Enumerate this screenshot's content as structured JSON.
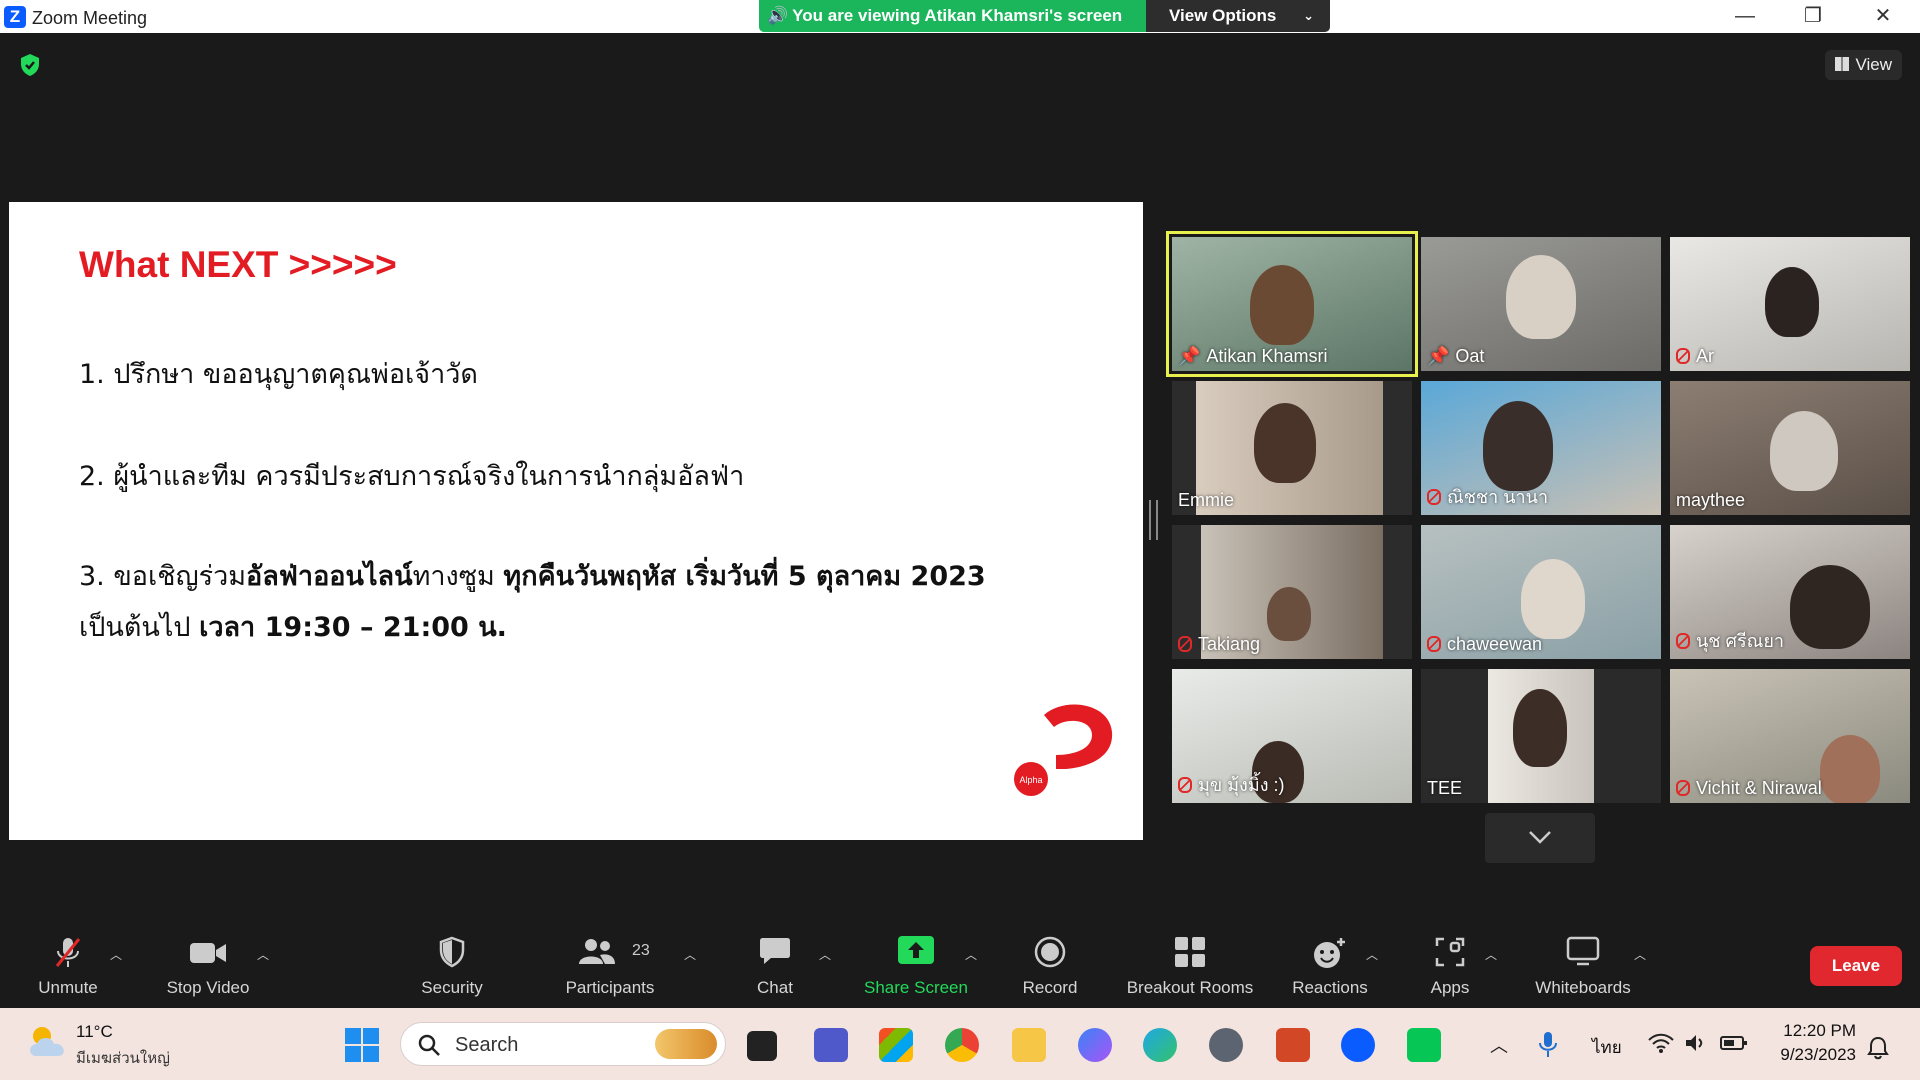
{
  "window": {
    "title": "Zoom Meeting",
    "viewing_banner": "You are viewing Atikan Khamsri's screen",
    "view_options": "View Options"
  },
  "view_button": "View",
  "slide": {
    "title": "What NEXT  >>>>>",
    "item1": "1. ปรึกษา ขออนุญาตคุณพ่อเจ้าวัด",
    "item2": "2. ผู้นำและทีม ควรมีประสบการณ์จริงในการนำกลุ่มอัลฟ่า",
    "item3_a": "3. ขอเชิญร่วม",
    "item3_b": "อัลฟ่าออนไลน์",
    "item3_c": "ทางซูม ",
    "item3_d": "ทุกคืนวันพฤหัส เริ่มวันที่ 5 ตุลาคม 2023",
    "item3_e": "เป็นต้นไป ",
    "item3_f": "เวลา 19:30 – 21:00 น.",
    "logo_text": "Alpha"
  },
  "participants": [
    {
      "name": "Atikan Khamsri",
      "status": "pinned"
    },
    {
      "name": "Oat",
      "status": "pinned"
    },
    {
      "name": "Ar",
      "status": "muted"
    },
    {
      "name": "Emmie",
      "status": "none"
    },
    {
      "name": "ณิชชา นานา",
      "status": "muted"
    },
    {
      "name": "maythee",
      "status": "none"
    },
    {
      "name": "Takiang",
      "status": "muted"
    },
    {
      "name": "chaweewan",
      "status": "muted"
    },
    {
      "name": "นุช ศรีณยา",
      "status": "muted"
    },
    {
      "name": "มุข มุ้งมิ้ง :)",
      "status": "muted"
    },
    {
      "name": "TEE",
      "status": "none"
    },
    {
      "name": "Vichit & Nirawal",
      "status": "muted"
    }
  ],
  "toolbar": {
    "unmute": "Unmute",
    "stop_video": "Stop Video",
    "security": "Security",
    "participants": "Participants",
    "participants_count": "23",
    "chat": "Chat",
    "share_screen": "Share Screen",
    "record": "Record",
    "breakout_rooms": "Breakout Rooms",
    "reactions": "Reactions",
    "apps": "Apps",
    "whiteboards": "Whiteboards",
    "leave": "Leave"
  },
  "taskbar": {
    "weather_temp": "11°C",
    "weather_location": "มีเมฆส่วนใหญ่",
    "search_placeholder": "Search",
    "language": "ไทย",
    "time": "12:20 PM",
    "date": "9/23/2023"
  },
  "colors": {
    "slide_title": "#e31b23",
    "banner_green": "#1bb55c",
    "share_green": "#23d959",
    "leave_red": "#e0282e",
    "active_speaker": "#e7f04c"
  }
}
